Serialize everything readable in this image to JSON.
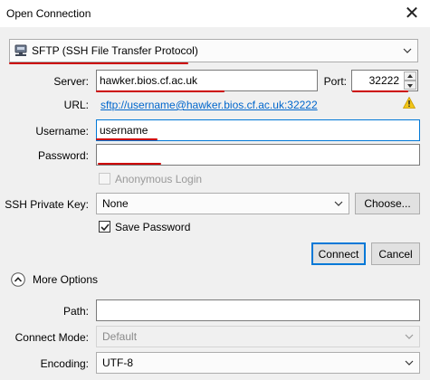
{
  "window": {
    "title": "Open Connection",
    "close_glyph": "✕"
  },
  "protocol": {
    "selected": "SFTP (SSH File Transfer Protocol)",
    "icon": "network-disk-icon"
  },
  "server": {
    "label": "Server:",
    "value": "hawker.bios.cf.ac.uk"
  },
  "port": {
    "label": "Port:",
    "value": "32222"
  },
  "url": {
    "label": "URL:",
    "value": "sftp://username@hawker.bios.cf.ac.uk:32222",
    "warning_icon": "warning-icon"
  },
  "username": {
    "label": "Username:",
    "value": "username"
  },
  "password": {
    "label": "Password:",
    "value": ""
  },
  "anonymous": {
    "label": "Anonymous Login",
    "checked": false,
    "enabled": false
  },
  "ssh_key": {
    "label": "SSH Private Key:",
    "selected": "None",
    "choose_label": "Choose..."
  },
  "save_password": {
    "label": "Save Password",
    "checked": true
  },
  "buttons": {
    "connect": "Connect",
    "cancel": "Cancel"
  },
  "more_options": {
    "label": "More Options",
    "icon": "chevron-up-icon"
  },
  "path": {
    "label": "Path:",
    "value": ""
  },
  "connect_mode": {
    "label": "Connect Mode:",
    "selected": "Default"
  },
  "encoding": {
    "label": "Encoding:",
    "selected": "UTF-8"
  },
  "colors": {
    "annotation": "#cc0000",
    "link": "#0066cc",
    "focus": "#0078d7"
  }
}
